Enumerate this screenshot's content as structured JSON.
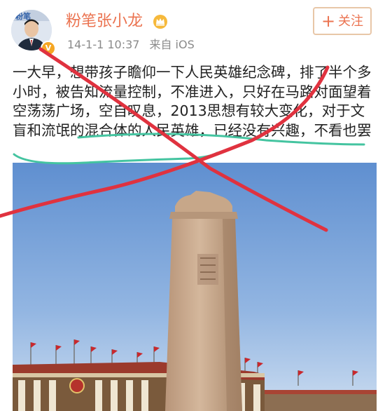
{
  "post": {
    "author": {
      "name": "粉笔张小龙",
      "verified_badge": "V",
      "avatar_icon": "avatar-icon",
      "crown_icon": "crown-icon"
    },
    "timestamp": "14-1-1 10:37",
    "source": "来自 iOS",
    "follow_button": {
      "icon": "+",
      "label": "关注"
    },
    "text": "一大早，想带孩子瞻仰一下人民英雄纪念碑，排了半个多小时，被告知流量控制，不准进入，只好在马路对面望着空荡荡广场，空自叹息，2013思想有较大变化，对于文盲和流氓的混合体的人民英雄，已经没有兴趣，不看也罢",
    "photo": {
      "subject": "monument-photo"
    }
  },
  "colors": {
    "username": "#eb7350",
    "meta": "#8a8a8a",
    "follow_border": "#e8c7a8",
    "red_cross": "#e0323f",
    "green_underline": "#44c4a0",
    "sky_top": "#6e9bd6",
    "sky_bottom": "#c8d9ef",
    "monument": "#c9a98c"
  }
}
